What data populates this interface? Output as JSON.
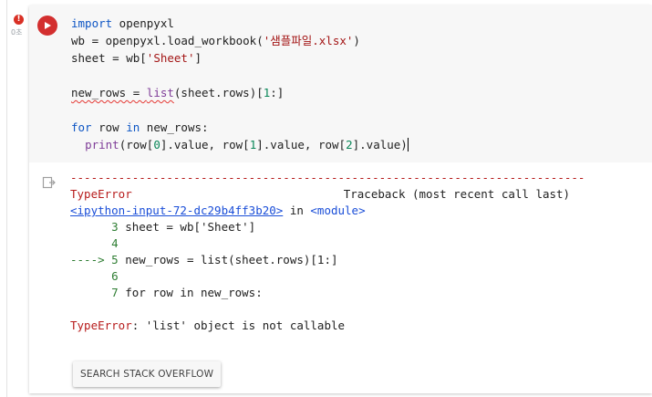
{
  "cell_status": {
    "error_badge": "!",
    "exec_time": "0초"
  },
  "code": {
    "line1": {
      "kw": "import",
      "rest": " openpyxl"
    },
    "line2": {
      "a": "wb = openpyxl.load_workbook(",
      "str": "'샘플파일.xlsx'",
      "b": ")"
    },
    "line3": {
      "a": "sheet = wb[",
      "str": "'Sheet'",
      "b": "]"
    },
    "line5": {
      "a": "new_rows = ",
      "fn": "list",
      "b": "(sheet.rows)[",
      "num": "1",
      "c": ":]"
    },
    "line7": {
      "kw": "for",
      "a": " row ",
      "kw2": "in",
      "b": " new_rows:"
    },
    "line8": {
      "indent": "  ",
      "fn": "print",
      "a": "(row[",
      "n0": "0",
      "b": "].value, row[",
      "n1": "1",
      "c": "].value, row[",
      "n2": "2",
      "d": "].value)"
    }
  },
  "output": {
    "divider": "---------------------------------------------------------------------------",
    "error_type": "TypeError",
    "traceback_header": "Traceback (most recent call last)",
    "input_link": "<ipython-input-72-dc29b4ff3b20>",
    "in_text": " in ",
    "module": "<module>",
    "tb1": {
      "num": "      3",
      "code": " sheet = wb['Sheet']"
    },
    "tb2": {
      "num": "      4",
      "code": ""
    },
    "tb3": {
      "arrow": "----> 5",
      "code": " new_rows = list(sheet.rows)[1:]"
    },
    "tb4": {
      "num": "      6",
      "code": ""
    },
    "tb5": {
      "num": "      7",
      "code": " for row in new_rows:"
    },
    "error_label": "TypeError",
    "error_message": ": 'list' object is not callable"
  },
  "buttons": {
    "search_stack_overflow": "SEARCH STACK OVERFLOW"
  },
  "colors": {
    "run_button": "#d32f2f",
    "keyword": "#0d55c4",
    "string": "#a31515",
    "error_red": "#b71c1c",
    "link_blue": "#1a4ed8",
    "line_number_green": "#2e7d32"
  }
}
